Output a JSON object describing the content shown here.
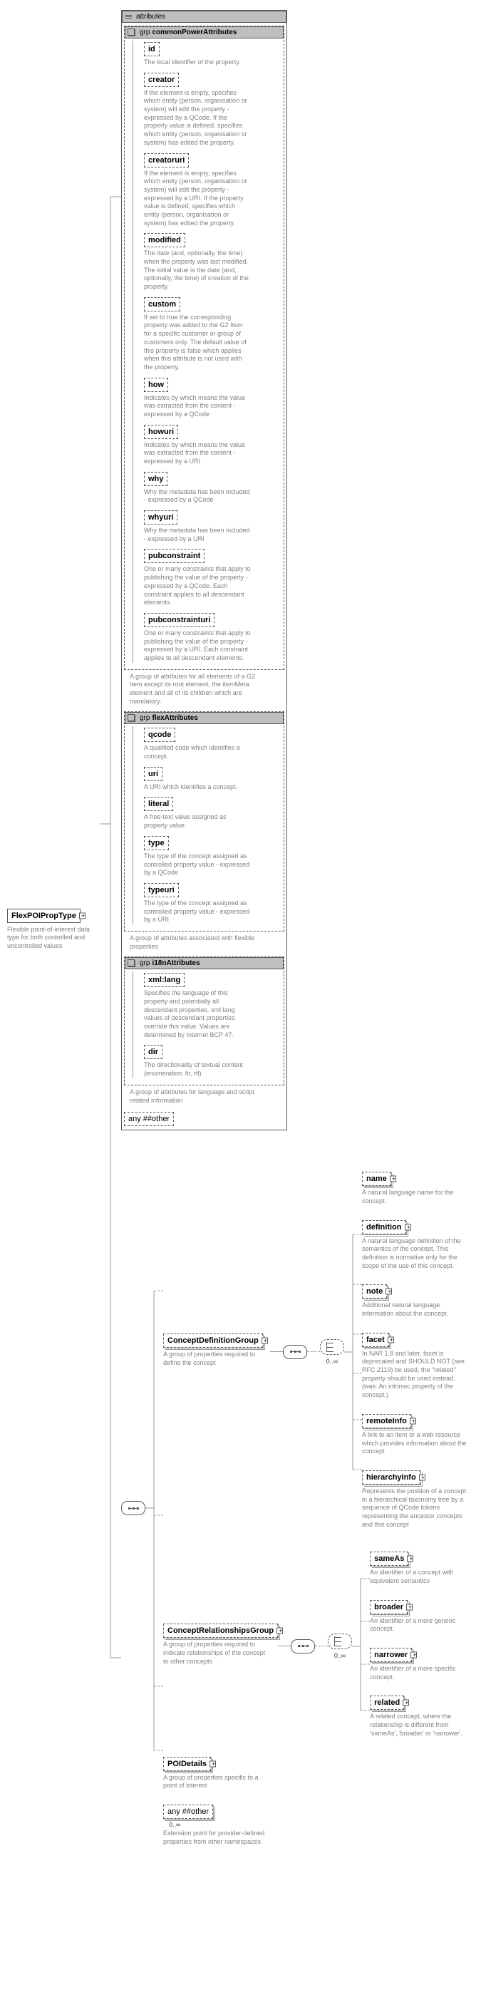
{
  "root": {
    "name": "FlexPOIPropType",
    "desc": "Flexible point-of-interest data type for both controlled and uncontrolled values"
  },
  "attrs_header": "attributes",
  "grp_label": "grp",
  "commonPower": {
    "title": "commonPowerAttributes",
    "caption": "A group of attributes for all elements of a G2 Item except its root element, the itemMeta element and all of its children which are mandatory.",
    "items": [
      {
        "name": "id",
        "desc": "The local identifier of the property."
      },
      {
        "name": "creator",
        "desc": "If the element is empty, specifies which entity (person, organisation or system) will edit the property - expressed by a QCode. If the property value is defined, specifies which entity (person, organisation or system) has edited the property."
      },
      {
        "name": "creatoruri",
        "desc": "If the element is empty, specifies which entity (person, organisation or system) will edit the property - expressed by a URI. If the property value is defined, specifies which entity (person, organisation or system) has edited the property."
      },
      {
        "name": "modified",
        "desc": "The date (and, optionally, the time) when the property was last modified. The initial value is the date (and, optionally, the time) of creation of the property."
      },
      {
        "name": "custom",
        "desc": "If set to true the corresponding property was added to the G2 Item for a specific customer or group of customers only. The default value of this property is false which applies when this attribute is not used with the property."
      },
      {
        "name": "how",
        "desc": "Indicates by which means the value was extracted from the content - expressed by a QCode"
      },
      {
        "name": "howuri",
        "desc": "Indicates by which means the value was extracted from the content - expressed by a URI"
      },
      {
        "name": "why",
        "desc": "Why the metadata has been included - expressed by a QCode"
      },
      {
        "name": "whyuri",
        "desc": "Why the metadata has been included - expressed by a URI"
      },
      {
        "name": "pubconstraint",
        "desc": "One or many constraints that apply to publishing the value of the property - expressed by a QCode. Each constraint applies to all descendant elements."
      },
      {
        "name": "pubconstrainturi",
        "desc": "One or many constraints that apply to publishing the value of the property - expressed by a URI. Each constraint applies to all descendant elements."
      }
    ]
  },
  "flex": {
    "title": "flexAttributes",
    "caption": "A group of attributes associated with flexible properties",
    "items": [
      {
        "name": "qcode",
        "desc": "A qualified code which identifies a concept."
      },
      {
        "name": "uri",
        "desc": "A URI which identifies a concept."
      },
      {
        "name": "literal",
        "desc": "A free-text value assigned as property value."
      },
      {
        "name": "type",
        "desc": "The type of the concept assigned as controlled property value - expressed by a QCode"
      },
      {
        "name": "typeuri",
        "desc": "The type of the concept assigned as controlled property value - expressed by a URI"
      }
    ]
  },
  "i18n": {
    "title": "i18nAttributes",
    "caption": "A group of attributes for language and script related information",
    "items": [
      {
        "name": "xml:lang",
        "desc": "Specifies the language of this property and potentially all descendant properties. xml:lang values of descendant properties override this value. Values are determined by Internet BCP 47."
      },
      {
        "name": "dir",
        "desc": "The directionality of textual content (enumeration: ltr, rtl)"
      }
    ]
  },
  "any_other": "any ##other",
  "conceptDef": {
    "title": "ConceptDefinitionGroup",
    "desc": "A group of properties required to define the concept",
    "items": [
      {
        "name": "name",
        "desc": "A natural language name for the concept."
      },
      {
        "name": "definition",
        "desc": "A natural language definition of the semantics of the concept. This definition is normative only for the scope of the use of this concept."
      },
      {
        "name": "note",
        "desc": "Additional natural language information about the concept."
      },
      {
        "name": "facet",
        "desc": "In NAR 1.8 and later, facet is deprecated and SHOULD NOT (see RFC 2119) be used, the \"related\" property should be used instead.(was: An intrinsic property of the concept.)"
      },
      {
        "name": "remoteInfo",
        "desc": "A link to an item or a web resource which provides information about the concept"
      },
      {
        "name": "hierarchyInfo",
        "desc": "Represents the position of a concept in a hierarchical taxonomy tree by a sequence of QCode tokens representing the ancestor concepts and this concept"
      }
    ]
  },
  "conceptRel": {
    "title": "ConceptRelationshipsGroup",
    "desc": "A group of properties required to indicate relationships of the concept to other concepts",
    "items": [
      {
        "name": "sameAs",
        "desc": "An identifier of a concept with equivalent semantics"
      },
      {
        "name": "broader",
        "desc": "An identifier of a more generic concept."
      },
      {
        "name": "narrower",
        "desc": "An identifier of a more specific concept."
      },
      {
        "name": "related",
        "desc": "A related concept, where the relationship is different from 'sameAs', 'broader' or 'narrower'."
      }
    ]
  },
  "poiDetails": {
    "name": "POIDetails",
    "desc": "A group of properties specific to a point of interest"
  },
  "any_other2": {
    "label": "any ##other",
    "occurs": "0..∞",
    "desc": "Extension point for provider-defined properties from other namespaces"
  },
  "occurs_unbounded": "0..∞"
}
